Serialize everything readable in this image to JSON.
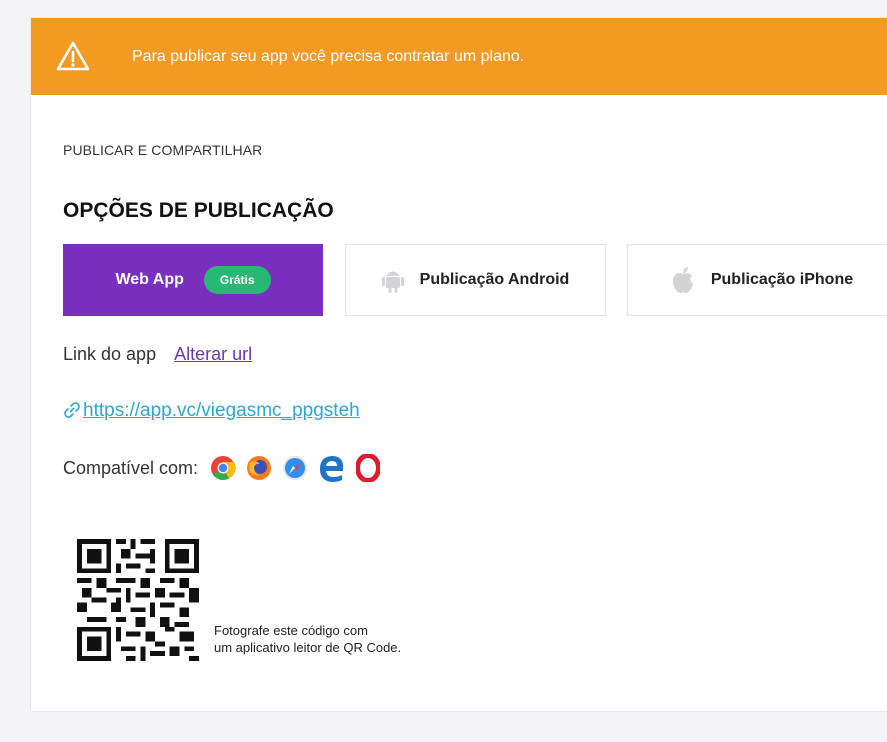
{
  "banner": {
    "text": "Para publicar seu app você precisa contratar um plano.",
    "icon": "warning-triangle-icon",
    "color": "#f39a22"
  },
  "section": {
    "label": "PUBLICAR E COMPARTILHAR",
    "title": "OPÇÕES DE PUBLICAÇÃO"
  },
  "options": {
    "web": {
      "label": "Web App",
      "badge": "Grátis",
      "color": "#7b2fbf"
    },
    "android": {
      "label": "Publicação Android",
      "icon": "android-icon"
    },
    "iphone": {
      "label": "Publicação iPhone",
      "icon": "apple-icon"
    }
  },
  "link": {
    "label": "Link do app",
    "change_label": "Alterar url",
    "url": "https://app.vc/viegasmc_ppgsteh"
  },
  "compat": {
    "label": "Compatível com:",
    "browsers": [
      "chrome-icon",
      "firefox-icon",
      "safari-icon",
      "edge-icon",
      "opera-icon"
    ]
  },
  "qr": {
    "line1": "Fotografe este código com",
    "line2": "um aplicativo leitor de QR Code."
  }
}
